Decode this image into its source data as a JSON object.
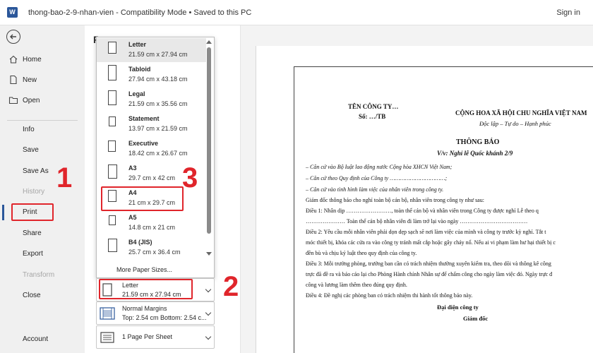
{
  "titlebar": {
    "app_icon": "word-icon",
    "title": "thong-bao-2-9-nhan-vien  -  Compatibility Mode  •  Saved to this PC",
    "sign_in": "Sign in"
  },
  "nav": {
    "items": [
      {
        "label": "Home",
        "icon": "home-icon"
      },
      {
        "label": "New",
        "icon": "new-doc-icon"
      },
      {
        "label": "Open",
        "icon": "folder-icon"
      },
      {
        "label": "Info"
      },
      {
        "label": "Save"
      },
      {
        "label": "Save As"
      },
      {
        "label": "History"
      },
      {
        "label": "Print"
      },
      {
        "label": "Share"
      },
      {
        "label": "Export"
      },
      {
        "label": "Transform"
      },
      {
        "label": "Close"
      },
      {
        "label": "Account"
      }
    ]
  },
  "print_pane": {
    "title_initial": "P"
  },
  "paper_sizes": {
    "items": [
      {
        "name": "Letter",
        "size": "21.59 cm x 27.94 cm"
      },
      {
        "name": "Tabloid",
        "size": "27.94 cm x 43.18 cm"
      },
      {
        "name": "Legal",
        "size": "21.59 cm x 35.56 cm"
      },
      {
        "name": "Statement",
        "size": "13.97 cm x 21.59 cm"
      },
      {
        "name": "Executive",
        "size": "18.42 cm x 26.67 cm"
      },
      {
        "name": "A3",
        "size": "29.7 cm x 42 cm"
      },
      {
        "name": "A4",
        "size": "21 cm x 29.7 cm"
      },
      {
        "name": "A5",
        "size": "14.8 cm x 21 cm"
      },
      {
        "name": "B4 (JIS)",
        "size": "25.7 cm x 36.4 cm"
      }
    ],
    "more": "More Paper Sizes..."
  },
  "settings": {
    "paper": {
      "line1": "Letter",
      "line2": "21.59 cm x 27.94 cm"
    },
    "margins": {
      "line1": "Normal Margins",
      "line2": "Top: 2.54 cm Bottom: 2.54 c..."
    },
    "pages_per_sheet": {
      "line1": "1 Page Per Sheet"
    }
  },
  "callouts": {
    "one": "1",
    "two": "2",
    "three": "3"
  },
  "colors": {
    "accent": "#2b579a",
    "highlight": "#e0252b"
  },
  "document": {
    "company": "TÊN CÔNG TY…",
    "number": "Số: …/TB",
    "nation": "CỘNG HOA XÃ HỘI CHU NGHĨA VIỆT NAM",
    "motto": "Độc lập – Tự do – Hạnh phúc",
    "heading": "THÔNG BÁO",
    "subject": "V/v: Nghỉ lễ Quốc khánh 2/9",
    "lines": [
      "– Căn cứ vào Bộ luật lao động nước Cộng hòa XHCN Việt Nam;",
      "– Căn cứ theo Quy định của Công ty ……………………………;",
      "– Căn cứ vào tình hình làm việc của nhân viên trong công ty.",
      "Giám đốc thông báo cho nghỉ toàn bộ cán bộ, nhân viên trong công ty như sau:",
      "Điều 1: Nhân dịp ……………………, toàn thể cán bộ và nhân viên trong Công ty được nghỉ Lễ theo q",
      "………………… Toàn thể cán bộ nhân viên đi làm trở lại vào ngày ………………………………",
      "Điều 2: Yêu cầu mỗi nhân viên phải dọn dẹp sạch sẽ nơi làm việc của mình và công ty trước kỳ nghỉ. Tắt t",
      "móc thiết bị, khóa các cửa ra vào công ty tránh mất cắp hoặc gây cháy nổ. Nếu ai vi phạm làm hư hại thiết bị c",
      "đền bù và chịu kỷ luật theo quy định của công ty.",
      "Điều 3: Mỗi trưởng phòng, trưởng ban cần có trách nhiệm thường xuyên kiểm tra, theo dõi và thông kê công",
      "trực đã đề ra và báo cáo lại cho Phòng Hành chính Nhân sự để chấm công cho ngày làm việc đó. Ngày trực đ",
      "công và lương làm thêm theo đúng quy định.",
      "Điều 4: Đề nghị các phòng ban có trách nhiệm thi hành tốt thông báo này."
    ],
    "rep": "Đại diện công ty",
    "director": "Giám đốc"
  }
}
